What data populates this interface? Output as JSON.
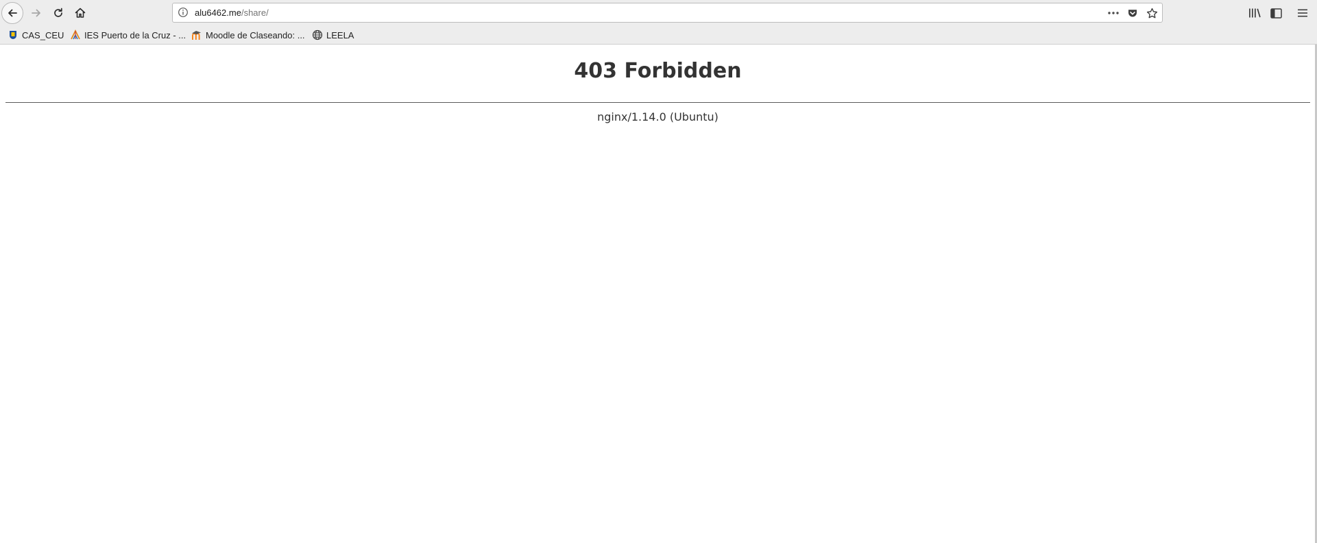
{
  "browser": {
    "url": {
      "host": "alu6462.me",
      "path": "/share/"
    },
    "icons": {
      "back": "back-arrow-icon",
      "forward": "forward-arrow-icon",
      "reload": "reload-icon",
      "home": "home-icon",
      "site_info": "info-icon",
      "page_actions": "more-horizontal-icon",
      "pocket": "pocket-icon",
      "bookmark_star": "star-icon",
      "library": "library-icon",
      "sidebar": "sidebar-icon",
      "menu": "hamburger-menu-icon"
    },
    "bookmarks": [
      {
        "label": "CAS_CEU",
        "icon": "cas-ceu-favicon"
      },
      {
        "label": "IES Puerto de la Cruz - ...",
        "icon": "ies-favicon"
      },
      {
        "label": "Moodle de Claseando: ...",
        "icon": "moodle-favicon"
      },
      {
        "label": "LEELA",
        "icon": "globe-icon"
      }
    ]
  },
  "page": {
    "heading": "403 Forbidden",
    "server_signature": "nginx/1.14.0 (Ubuntu)"
  },
  "colors": {
    "toolbar_bg": "#ededed",
    "text": "#333333",
    "moodle_orange": "#f98012"
  }
}
